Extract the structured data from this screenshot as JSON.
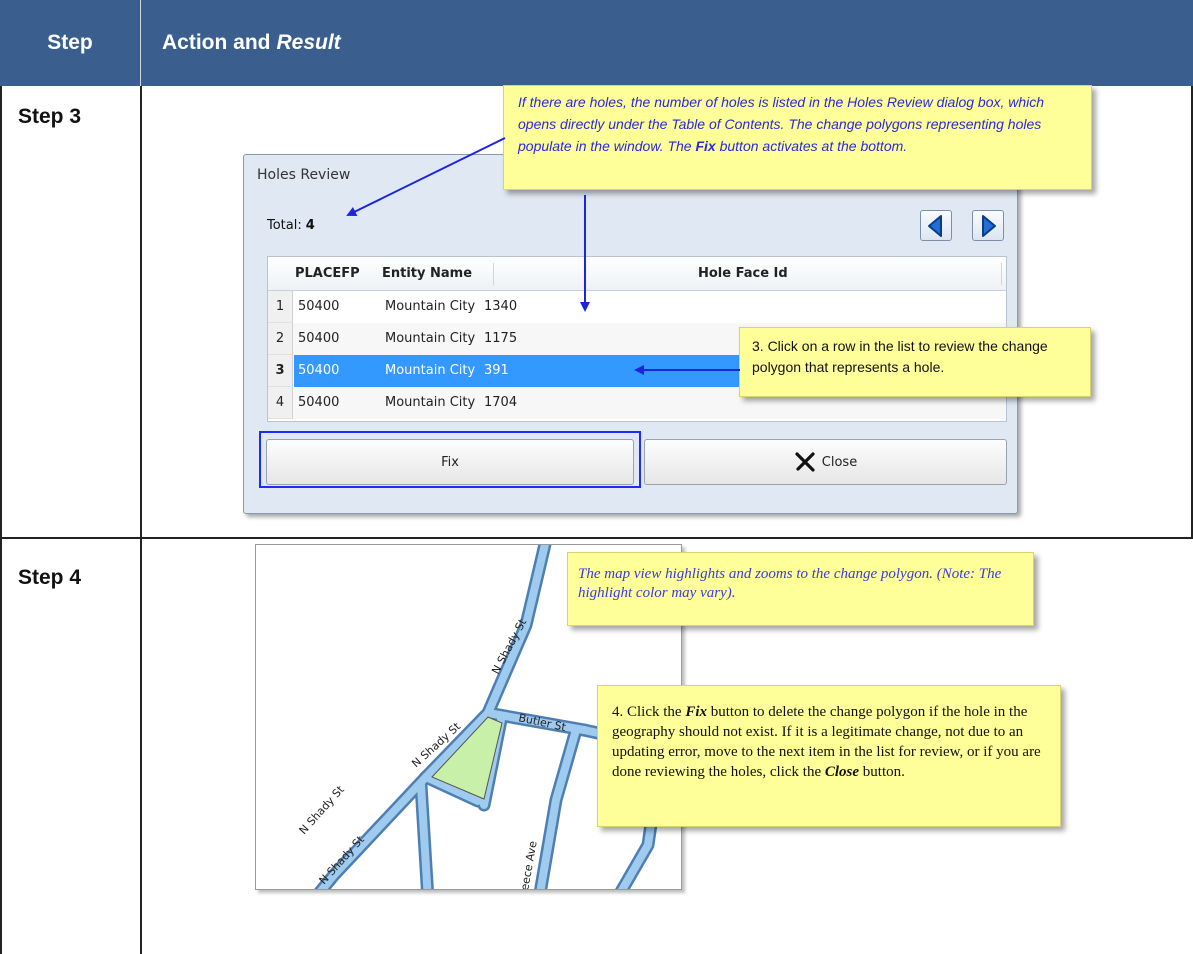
{
  "header": {
    "step": "Step",
    "action": "Action and",
    "result": "Result",
    "bg_color": "#3a5f8f"
  },
  "rows": [
    {
      "label": "Step 3"
    },
    {
      "label": "Step 4"
    }
  ],
  "dialog": {
    "title": "Holes Review",
    "total_label": "Total:",
    "total_value": "4",
    "columns": [
      "PLACEFP",
      "Entity Name",
      "Hole Face Id"
    ],
    "rows": [
      {
        "n": "1",
        "placefp": "50400",
        "entity": "Mountain City",
        "hole": "1340"
      },
      {
        "n": "2",
        "placefp": "50400",
        "entity": "Mountain City",
        "hole": "1175"
      },
      {
        "n": "3",
        "placefp": "50400",
        "entity": "Mountain City",
        "hole": "391",
        "selected": true
      },
      {
        "n": "4",
        "placefp": "50400",
        "entity": "Mountain City",
        "hole": "1704"
      }
    ],
    "fix_label": "Fix",
    "close_label": "Close",
    "prev_icon": "arrow-left-icon",
    "next_icon": "arrow-right-icon"
  },
  "callouts": {
    "holes_info_1": "If there are holes, the number of holes is listed in the Holes Review dialog box, which opens directly under the Table of Contents. The change polygons representing holes populate in the window. The",
    "holes_info_fix": "Fix",
    "holes_info_2": "button activates at the bottom.",
    "click_row": "3. Click on a row in the list to review the change polygon that represents a hole.",
    "map_view": "The map view highlights and zooms to the change polygon. (Note: The highlight color may vary).",
    "step4_a": "4. Click the",
    "step4_fix": "Fix",
    "step4_b": "button to delete the change polygon if the hole in the geography should not exist. If it is a legitimate change, not due to an updating error, move to the next item in the list for review, or if you are done reviewing the holes, click the",
    "step4_close": "Close",
    "step4_c": "button."
  },
  "map": {
    "labels": [
      "N Shady St",
      "N Shady St",
      "Butler St",
      "N Shady St",
      "N Shady St",
      "eece Ave"
    ],
    "road_color": "#8cbde6",
    "polygon_color": "#c8f0a8"
  }
}
